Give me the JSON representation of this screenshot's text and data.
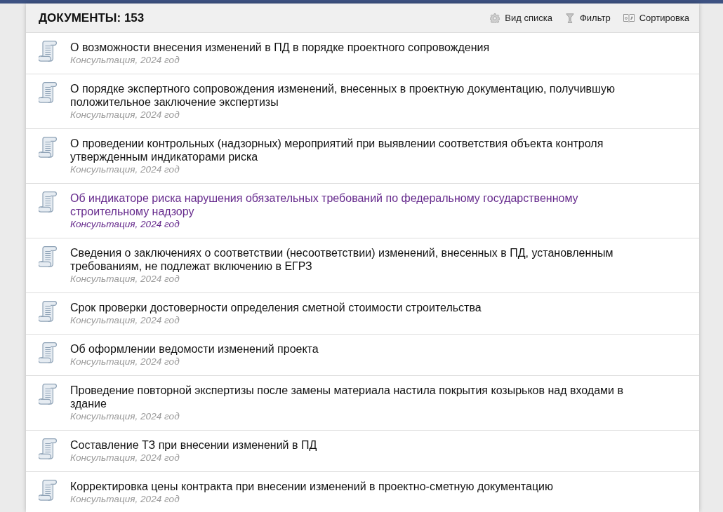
{
  "header": {
    "title": "ДОКУМЕНТЫ: 153",
    "actions": [
      {
        "label": "Вид списка",
        "kind": "view"
      },
      {
        "label": "Фильтр",
        "kind": "filter"
      },
      {
        "label": "Сортировка",
        "kind": "sort"
      }
    ]
  },
  "documents": [
    {
      "title": "О возможности внесения изменений в ПД в порядке проектного сопровождения",
      "meta": "Консультация, 2024 год",
      "visited": false
    },
    {
      "title": "О порядке экспертного сопровождения изменений, внесенных в проектную документацию, получившую положительное заключение экспертизы",
      "meta": "Консультация, 2024 год",
      "visited": false
    },
    {
      "title": "О проведении контрольных (надзорных) мероприятий при выявлении соответствия объекта контроля утвержденным индикаторами риска",
      "meta": "Консультация, 2024 год",
      "visited": false
    },
    {
      "title": "Об индикаторе риска нарушения обязательных требований по федеральному государственному строительному надзору",
      "meta": "Консультация, 2024 год",
      "visited": true
    },
    {
      "title": "Сведения о заключениях о соответствии (несоответствии) изменений, внесенных в ПД, установленным требованиям, не подлежат включению в ЕГРЗ",
      "meta": "Консультация, 2024 год",
      "visited": false
    },
    {
      "title": "Срок проверки достоверности определения сметной стоимости строительства",
      "meta": "Консультация, 2024 год",
      "visited": false
    },
    {
      "title": "Об оформлении ведомости изменений проекта",
      "meta": "Консультация, 2024 год",
      "visited": false
    },
    {
      "title": "Проведение повторной экспертизы после замены материала настила покрытия козырьков над входами в здание",
      "meta": "Консультация, 2024 год",
      "visited": false
    },
    {
      "title": "Составление ТЗ при внесении изменений в ПД",
      "meta": "Консультация, 2024 год",
      "visited": false
    },
    {
      "title": "Корректировка цены контракта при внесении изменений в проектно-сметную документацию",
      "meta": "Консультация, 2024 год",
      "visited": false
    }
  ]
}
